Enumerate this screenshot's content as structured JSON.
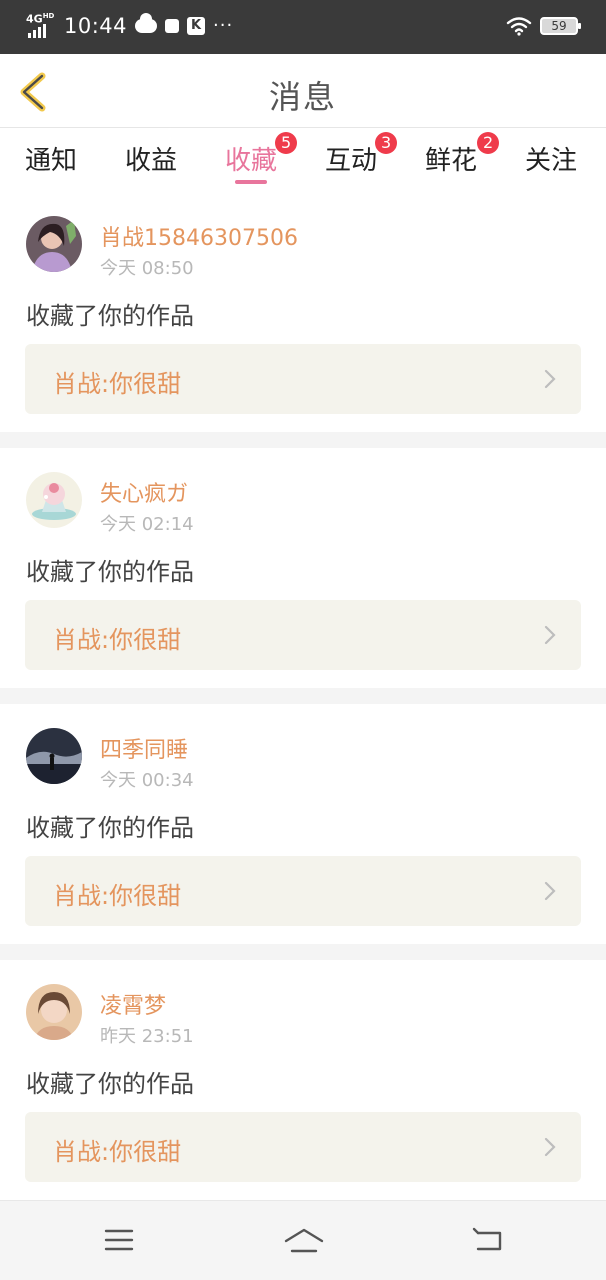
{
  "status_bar": {
    "network": "4G",
    "network_suffix": "HD",
    "time": "10:44",
    "more": "···",
    "k_badge": "K",
    "battery": "59"
  },
  "header": {
    "title": "消息"
  },
  "tabs": [
    {
      "label": "通知",
      "badge": ""
    },
    {
      "label": "收益",
      "badge": ""
    },
    {
      "label": "收藏",
      "badge": "5",
      "active": true
    },
    {
      "label": "互动",
      "badge": "3"
    },
    {
      "label": "鲜花",
      "badge": "2"
    },
    {
      "label": "关注",
      "badge": ""
    }
  ],
  "notifications": [
    {
      "user": "肖战15846307506",
      "time": "今天 08:50",
      "action": "收藏了你的作品",
      "work": "肖战:你很甜",
      "avatar_icon": "avatar-girl-purple"
    },
    {
      "user": "失心疯ガ",
      "time": "今天 02:14",
      "action": "收藏了你的作品",
      "work": "肖战:你很甜",
      "avatar_icon": "avatar-cupcake"
    },
    {
      "user": "四季同睡",
      "time": "今天 00:34",
      "action": "收藏了你的作品",
      "work": "肖战:你很甜",
      "avatar_icon": "avatar-night-sky"
    },
    {
      "user": "凌霄梦",
      "time": "昨天 23:51",
      "action": "收藏了你的作品",
      "work": "肖战:你很甜",
      "avatar_icon": "avatar-girl-warm"
    }
  ],
  "colors": {
    "accent_pink": "#e8759c",
    "username_orange": "#e4955e",
    "badge_red": "#ef3b4b",
    "back_arrow_yellow": "#f2c94c"
  }
}
